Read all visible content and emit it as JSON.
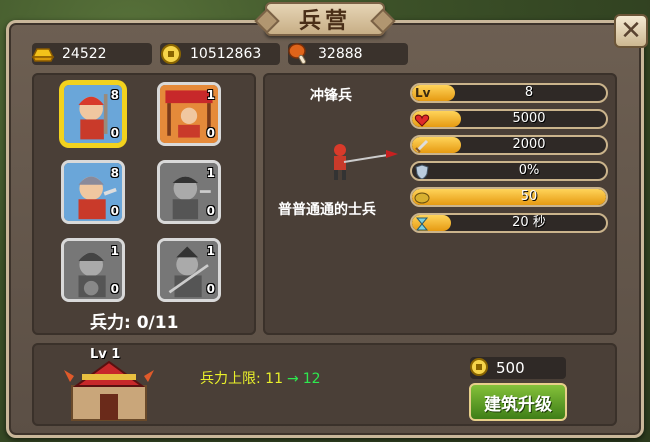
{
  "title": "兵营",
  "resources": {
    "gold": "24522",
    "coins": "10512863",
    "food": "32888"
  },
  "units": [
    {
      "top": "8",
      "bottom": "0",
      "unlocked": true,
      "selected": true
    },
    {
      "top": "1",
      "bottom": "0",
      "unlocked": true,
      "selected": false
    },
    {
      "top": "8",
      "bottom": "0",
      "unlocked": true,
      "selected": false
    },
    {
      "top": "1",
      "bottom": "0",
      "unlocked": false,
      "selected": false
    },
    {
      "top": "1",
      "bottom": "0",
      "unlocked": false,
      "selected": false
    },
    {
      "top": "1",
      "bottom": "0",
      "unlocked": false,
      "selected": false
    }
  ],
  "troops": "兵力: 0/11",
  "detail": {
    "name": "冲锋兵",
    "description": "普普通通的士兵",
    "stats": [
      {
        "icon": "level-badge",
        "label": "Lv",
        "value": "8",
        "fill": 0.22
      },
      {
        "icon": "heart-icon",
        "value": "5000",
        "fill": 0.25
      },
      {
        "icon": "sword-icon",
        "value": "2000",
        "fill": 0.25
      },
      {
        "icon": "shield-icon",
        "value": "0%",
        "fill": 0.0
      },
      {
        "icon": "food-cost-icon",
        "value": "50",
        "fill": 1.0
      },
      {
        "icon": "hourglass-icon",
        "value": "20 秒",
        "fill": 0.2
      }
    ]
  },
  "building": {
    "level": "Lv 1",
    "capacity_label": "兵力上限:",
    "capacity_current": "11",
    "capacity_arrow": "→",
    "capacity_next": "12",
    "cost": "500",
    "upgrade_label": "建筑升级"
  },
  "close_label": "✕"
}
